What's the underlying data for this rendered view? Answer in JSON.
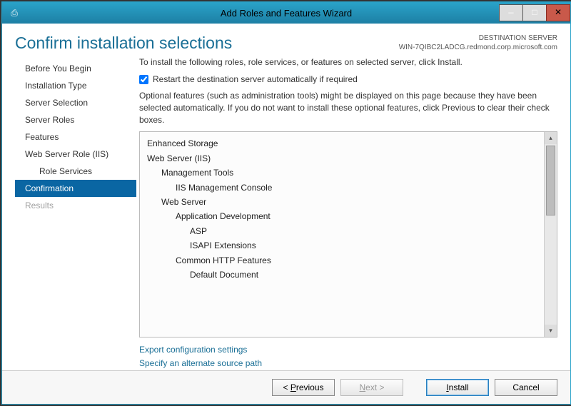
{
  "window": {
    "title": "Add Roles and Features Wizard"
  },
  "titlebar_icons": {
    "print": "⎙",
    "min": "—",
    "max": "□",
    "close": "✕"
  },
  "header": {
    "page_title": "Confirm installation selections",
    "dest_label": "DESTINATION SERVER",
    "dest_server": "WIN-7QIBC2LADCG.redmond.corp.microsoft.com"
  },
  "sidebar": {
    "steps": [
      {
        "label": "Before You Begin",
        "state": "enabled"
      },
      {
        "label": "Installation Type",
        "state": "enabled"
      },
      {
        "label": "Server Selection",
        "state": "enabled"
      },
      {
        "label": "Server Roles",
        "state": "enabled"
      },
      {
        "label": "Features",
        "state": "enabled"
      },
      {
        "label": "Web Server Role (IIS)",
        "state": "enabled"
      },
      {
        "label": "Role Services",
        "state": "enabled",
        "sub": true
      },
      {
        "label": "Confirmation",
        "state": "active"
      },
      {
        "label": "Results",
        "state": "disabled"
      }
    ]
  },
  "content": {
    "instruction": "To install the following roles, role services, or features on selected server, click Install.",
    "restart_checkbox_label": "Restart the destination server automatically if required",
    "restart_checked": true,
    "optional_text": "Optional features (such as administration tools) might be displayed on this page because they have been selected automatically. If you do not want to install these optional features, click Previous to clear their check boxes.",
    "features": [
      {
        "text": "Enhanced Storage",
        "indent": 0
      },
      {
        "text": "Web Server (IIS)",
        "indent": 0
      },
      {
        "text": "Management Tools",
        "indent": 1
      },
      {
        "text": "IIS Management Console",
        "indent": 2
      },
      {
        "text": "Web Server",
        "indent": 1
      },
      {
        "text": "Application Development",
        "indent": 2
      },
      {
        "text": "ASP",
        "indent": 3
      },
      {
        "text": "ISAPI Extensions",
        "indent": 3
      },
      {
        "text": "Common HTTP Features",
        "indent": 2
      },
      {
        "text": "Default Document",
        "indent": 3
      }
    ],
    "links": {
      "export": "Export configuration settings",
      "alt_source": "Specify an alternate source path"
    }
  },
  "footer": {
    "previous_prefix": "< ",
    "previous_key": "P",
    "previous_rest": "revious",
    "next_key": "N",
    "next_rest": "ext >",
    "install_key": "I",
    "install_rest": "nstall",
    "cancel": "Cancel"
  }
}
